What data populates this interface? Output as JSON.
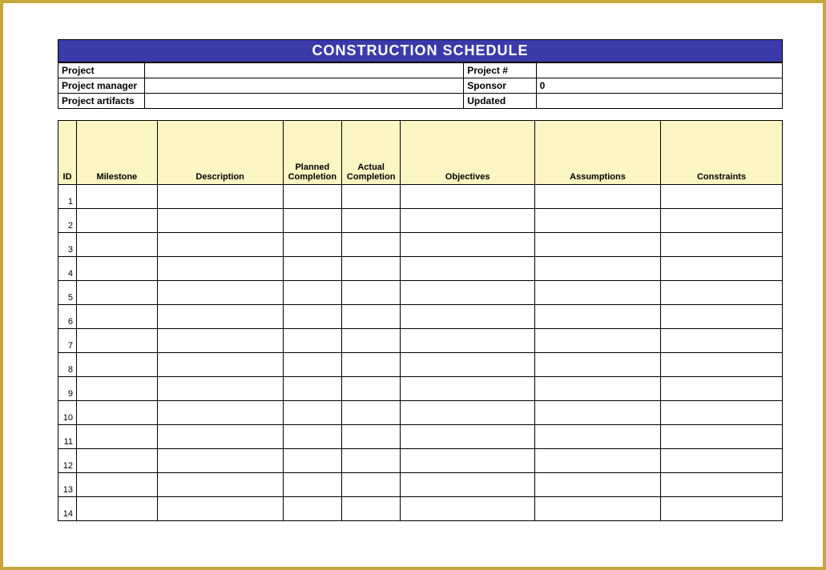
{
  "title": "CONSTRUCTION SCHEDULE",
  "info": {
    "project_label": "Project",
    "project_value": "",
    "project_num_label": "Project #",
    "project_num_value": "",
    "manager_label": "Project manager",
    "manager_value": "",
    "sponsor_label": "Sponsor",
    "sponsor_value": "0",
    "artifacts_label": "Project artifacts",
    "artifacts_value": "",
    "updated_label": "Updated",
    "updated_value": ""
  },
  "columns": {
    "id": "ID",
    "milestone": "Milestone",
    "description": "Description",
    "planned": "Planned Completion",
    "actual": "Actual Completion",
    "objectives": "Objectives",
    "assumptions": "Assumptions",
    "constraints": "Constraints"
  },
  "rows": [
    {
      "id": "1",
      "milestone": "",
      "description": "",
      "planned": "",
      "actual": "",
      "objectives": "",
      "assumptions": "",
      "constraints": ""
    },
    {
      "id": "2",
      "milestone": "",
      "description": "",
      "planned": "",
      "actual": "",
      "objectives": "",
      "assumptions": "",
      "constraints": ""
    },
    {
      "id": "3",
      "milestone": "",
      "description": "",
      "planned": "",
      "actual": "",
      "objectives": "",
      "assumptions": "",
      "constraints": ""
    },
    {
      "id": "4",
      "milestone": "",
      "description": "",
      "planned": "",
      "actual": "",
      "objectives": "",
      "assumptions": "",
      "constraints": ""
    },
    {
      "id": "5",
      "milestone": "",
      "description": "",
      "planned": "",
      "actual": "",
      "objectives": "",
      "assumptions": "",
      "constraints": ""
    },
    {
      "id": "6",
      "milestone": "",
      "description": "",
      "planned": "",
      "actual": "",
      "objectives": "",
      "assumptions": "",
      "constraints": ""
    },
    {
      "id": "7",
      "milestone": "",
      "description": "",
      "planned": "",
      "actual": "",
      "objectives": "",
      "assumptions": "",
      "constraints": ""
    },
    {
      "id": "8",
      "milestone": "",
      "description": "",
      "planned": "",
      "actual": "",
      "objectives": "",
      "assumptions": "",
      "constraints": ""
    },
    {
      "id": "9",
      "milestone": "",
      "description": "",
      "planned": "",
      "actual": "",
      "objectives": "",
      "assumptions": "",
      "constraints": ""
    },
    {
      "id": "10",
      "milestone": "",
      "description": "",
      "planned": "",
      "actual": "",
      "objectives": "",
      "assumptions": "",
      "constraints": ""
    },
    {
      "id": "11",
      "milestone": "",
      "description": "",
      "planned": "",
      "actual": "",
      "objectives": "",
      "assumptions": "",
      "constraints": ""
    },
    {
      "id": "12",
      "milestone": "",
      "description": "",
      "planned": "",
      "actual": "",
      "objectives": "",
      "assumptions": "",
      "constraints": ""
    },
    {
      "id": "13",
      "milestone": "",
      "description": "",
      "planned": "",
      "actual": "",
      "objectives": "",
      "assumptions": "",
      "constraints": ""
    },
    {
      "id": "14",
      "milestone": "",
      "description": "",
      "planned": "",
      "actual": "",
      "objectives": "",
      "assumptions": "",
      "constraints": ""
    }
  ]
}
